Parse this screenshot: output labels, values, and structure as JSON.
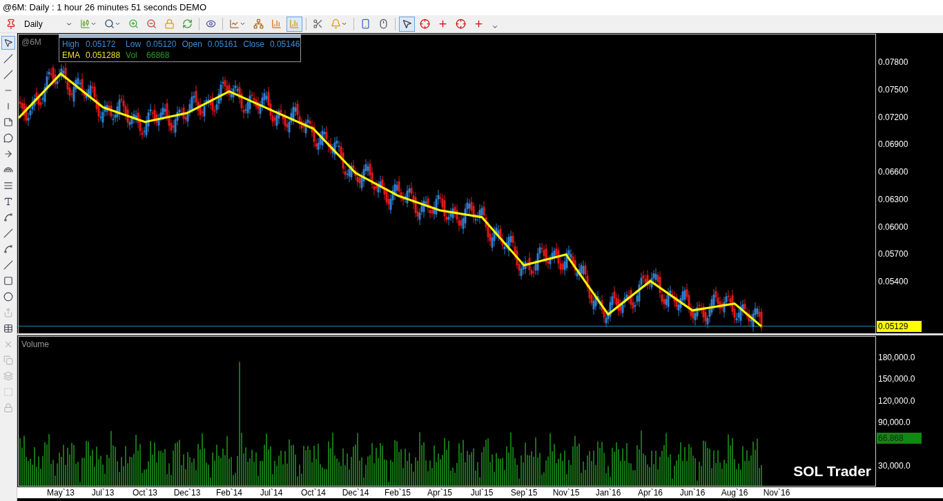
{
  "window": {
    "title": "@6M: Daily : 1 hour 26 minutes 51 seconds DEMO"
  },
  "toolbar": {
    "timeframe": "Daily",
    "tools": [
      {
        "selected": false
      },
      {
        "selected": false
      },
      {
        "selected": false
      },
      {
        "selected": false
      },
      {
        "selected": false
      },
      {
        "selected": false
      },
      {
        "selected": false
      },
      {
        "selected": false
      },
      {
        "selected": false
      },
      {
        "selected": false
      },
      {
        "selected": true
      },
      {
        "selected": false
      },
      {
        "selected": false
      },
      {
        "selected": false
      },
      {
        "selected": false
      },
      {
        "selected": true
      },
      {
        "selected": false
      },
      {
        "selected": false
      },
      {
        "selected": false
      },
      {
        "selected": false
      }
    ]
  },
  "drawing_tools": [
    {
      "selected": true,
      "disabled": false
    },
    {
      "selected": false,
      "disabled": false
    },
    {
      "selected": false,
      "disabled": false
    },
    {
      "selected": false,
      "disabled": false
    },
    {
      "selected": false,
      "disabled": false
    },
    {
      "selected": false,
      "disabled": false
    },
    {
      "selected": false,
      "disabled": false
    },
    {
      "selected": false,
      "disabled": false
    },
    {
      "selected": false,
      "disabled": false
    },
    {
      "selected": false,
      "disabled": false
    },
    {
      "selected": false,
      "disabled": false
    },
    {
      "selected": false,
      "disabled": false
    },
    {
      "selected": false,
      "disabled": false
    },
    {
      "selected": false,
      "disabled": false
    },
    {
      "selected": false,
      "disabled": false
    },
    {
      "selected": false,
      "disabled": false
    },
    {
      "selected": false,
      "disabled": false
    },
    {
      "selected": false,
      "disabled": true
    },
    {
      "selected": false,
      "disabled": false
    },
    {
      "selected": false,
      "disabled": true
    },
    {
      "selected": false,
      "disabled": true
    },
    {
      "selected": false,
      "disabled": true
    },
    {
      "selected": false,
      "disabled": true
    },
    {
      "selected": false,
      "disabled": true
    }
  ],
  "price_panel": {
    "symbol": "@6M",
    "quote": [
      {
        "label": "High",
        "value": "0.05172",
        "kind": "price"
      },
      {
        "label": "Low",
        "value": "0.05120",
        "kind": "price"
      },
      {
        "label": "Open",
        "value": "0.05161",
        "kind": "price"
      },
      {
        "label": "Close",
        "value": "0.05146",
        "kind": "price"
      },
      {
        "label": "EMA",
        "value": "0.051288",
        "kind": "ema"
      },
      {
        "label": "Vol",
        "value": "66868",
        "kind": "volume"
      }
    ],
    "last_price": "0.05129",
    "axis_labels": [
      "0.07800",
      "0.07500",
      "0.07200",
      "0.06900",
      "0.06600",
      "0.06300",
      "0.06000",
      "0.05700",
      "0.05400"
    ]
  },
  "volume_panel": {
    "title": "Volume",
    "last_volume": "66,868",
    "axis_labels": [
      "180,000.0",
      "150,000.0",
      "120,000.0",
      "90,000.0",
      "30,000.0"
    ],
    "brand": "SOL Trader"
  },
  "date_axis": {
    "labels": [
      "May`13",
      "Jul`13",
      "Oct`13",
      "Dec`13",
      "Feb`14",
      "Jul`14",
      "Oct`14",
      "Dec`14",
      "Feb`15",
      "Apr`15",
      "Jul`15",
      "Sep`15",
      "Nov`15",
      "Jan`16",
      "Apr`16",
      "Jun`16",
      "Aug`16",
      "Nov`16"
    ]
  }
}
